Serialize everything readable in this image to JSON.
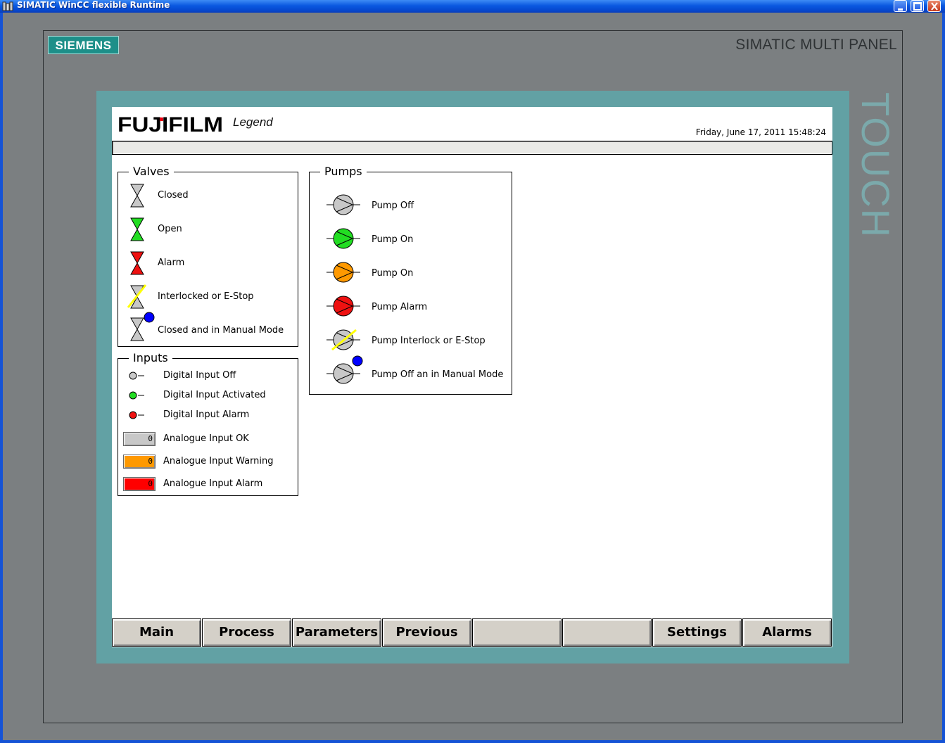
{
  "window": {
    "title": "SIMATIC WinCC flexible Runtime"
  },
  "panel": {
    "brand": "SIEMENS",
    "model": "SIMATIC MULTI PANEL",
    "touch_label": "TOUCH"
  },
  "header": {
    "logo": "FUJIFILM",
    "screen_title": "Legend",
    "datetime": "Friday, June 17, 2011 15:48:24"
  },
  "valves": {
    "title": "Valves",
    "items": [
      {
        "label": "Closed",
        "icon": "valve-closed-icon",
        "color": "#c8c8c8"
      },
      {
        "label": "Open",
        "icon": "valve-open-icon",
        "color": "#22dd22"
      },
      {
        "label": "Alarm",
        "icon": "valve-alarm-icon",
        "color": "#ee1111"
      },
      {
        "label": "Interlocked or E-Stop",
        "icon": "valve-interlock-icon",
        "color": "#c8c8c8"
      },
      {
        "label": "Closed and in Manual Mode",
        "icon": "valve-manual-icon",
        "color": "#c8c8c8"
      }
    ]
  },
  "pumps": {
    "title": "Pumps",
    "items": [
      {
        "label": "Pump Off",
        "icon": "pump-off-icon",
        "color": "#c8c8c8"
      },
      {
        "label": "Pump On",
        "icon": "pump-on-green-icon",
        "color": "#22dd22"
      },
      {
        "label": "Pump On",
        "icon": "pump-on-orange-icon",
        "color": "#ff9900"
      },
      {
        "label": "Pump Alarm",
        "icon": "pump-alarm-icon",
        "color": "#ee1111"
      },
      {
        "label": "Pump Interlock or E-Stop",
        "icon": "pump-interlock-icon",
        "color": "#c8c8c8"
      },
      {
        "label": "Pump Off an in Manual Mode",
        "icon": "pump-manual-icon",
        "color": "#c8c8c8"
      }
    ]
  },
  "inputs": {
    "title": "Inputs",
    "digital": [
      {
        "label": "Digital Input Off",
        "color": "#c8c8c8"
      },
      {
        "label": "Digital Input Activated",
        "color": "#22dd22"
      },
      {
        "label": "Digital Input Alarm",
        "color": "#ee1111"
      }
    ],
    "analogue": [
      {
        "label": "Analogue Input OK",
        "value": "0",
        "color": "#c8c8c8"
      },
      {
        "label": "Analogue Input Warning",
        "value": "0",
        "color": "#ff9900"
      },
      {
        "label": "Analogue Input Alarm",
        "value": "0",
        "color": "#ff0000"
      }
    ]
  },
  "nav": {
    "buttons": [
      "Main",
      "Process",
      "Parameters",
      "Previous",
      "",
      "",
      "Settings",
      "Alarms"
    ]
  },
  "colors": {
    "manual_mode_dot": "#0000ff",
    "interlock_slash": "#ffff00",
    "bezel": "#7b7f81",
    "screen_border": "#62a1a4"
  }
}
